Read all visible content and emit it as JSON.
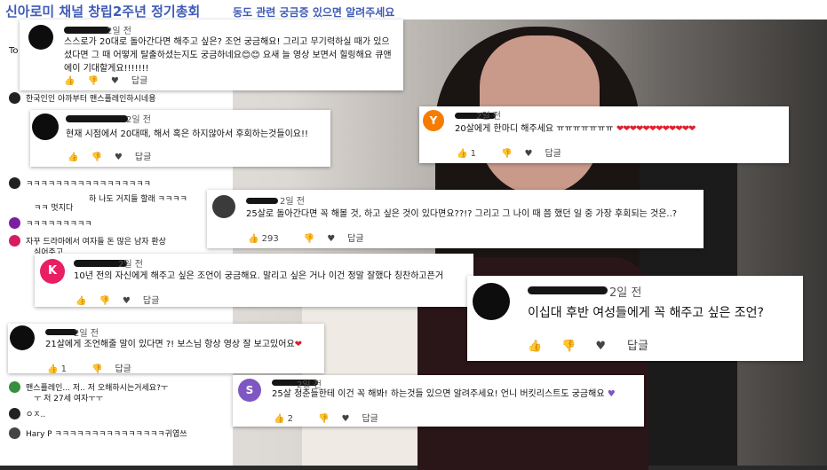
{
  "header": {
    "title": "신아로미 채널 창립2주년 정기총회",
    "subtitle": "동도 관련 궁금증 있으면 알려주세요"
  },
  "left_panel": {
    "tab": "To",
    "rows": [
      {
        "name": "한국인인 아까부터 맨스플레인하시네용"
      },
      {
        "name": "ㅋㅋㅋㅋㅋㅋㅋㅋㅋㅋㅋㅋㅋㅋㅋㅋㅋ"
      },
      {
        "name": "하 나도 거지들 할래 ㅋㅋㅋㅋ"
      },
      {
        "name": "ㅋㅋ 멋지다"
      },
      {
        "name": "ㅋㅋㅋㅋㅋㅋㅋㅋㅋ"
      },
      {
        "name": "자꾸 드라마에서 여자들 돈 많은 남자 환상"
      },
      {
        "name": "심어주고"
      },
      {
        "name": "맨스플레인... 저.. 저 오해하시는거세요?ㅜ"
      },
      {
        "name": "ㅜ 저 27세 여자ㅜㅜ"
      },
      {
        "name": "ㅇㅈ.."
      },
      {
        "name": "Hary P  ㅋㅋㅋㅋㅋㅋㅋㅋㅋㅋㅋㅋㅋㅋㅋ귀엽쓰"
      }
    ]
  },
  "comments": [
    {
      "id": "c1",
      "time": "2일 전",
      "text": "스스로가 20대로 돌아간다면 해주고 싶은? 조언 궁금해요! 그리고 무기력하실 때가 있으셨다면 그 때 어떻게 탈출하셨는지도 궁금하네요😊😊 요새 늘 영상 보면서 힐링해요 큐앤에이 기대할게요!!!!!!!",
      "likes": "",
      "reply": "답글"
    },
    {
      "id": "c2",
      "time": "2일 전",
      "text": "현재 시점에서 20대때, 해서 혹은 하지않아서 후회하는것들이요!!",
      "likes": "",
      "reply": "답글"
    },
    {
      "id": "c3",
      "letter": "Y",
      "color": "#f57c00",
      "time": "2일 전",
      "text": "20살에게 한마디 해주세요 ㅠㅠㅠㅠㅠㅠㅠ",
      "hearts": "❤❤❤❤❤❤❤❤❤❤❤❤",
      "likes": "1",
      "reply": "답글"
    },
    {
      "id": "c4",
      "time": "2일 전",
      "text": "25살로 돌아간다면 꼭 해볼 것, 하고 싶은 것이 있다면요??!? 그리고 그 나이 때 쯤 했던 일 중 가장 후회되는 것은..?",
      "likes": "293",
      "reply": "답글"
    },
    {
      "id": "c5",
      "letter": "K",
      "color": "#e91e63",
      "time": "2일 전",
      "text": "10년 전의 자신에게 해주고 싶은 조언이 궁금해요. 말리고 싶은 거나 이건 정말 잘했다 칭찬하고픈거",
      "likes": "",
      "reply": "답글"
    },
    {
      "id": "c6",
      "time": "2일 전",
      "text": "이십대 후반 여성들에게 꼭 해주고 싶은 조언?",
      "likes": "",
      "reply": "답글"
    },
    {
      "id": "c7",
      "time": "2일 전",
      "text": "21살에게 조언해줄 말이 있다면 ?! 보스님 항상 영상 잘 보고있어요",
      "likes": "1",
      "reply": "답글"
    },
    {
      "id": "c8",
      "letter": "S",
      "color": "#7e57c2",
      "time": "2일 전",
      "text": "25살 청춘들한테 이건 꼭 해봐! 하는것들 있으면 알려주세요! 언니 버킷리스트도 궁금해요",
      "likes": "2",
      "reply": "답글"
    }
  ],
  "icons": {
    "like": "thumbs-up-icon",
    "dislike": "thumbs-down-icon",
    "heart": "heart-icon"
  },
  "colors": {
    "heart": "#e01f2b",
    "title": "#3e5bb8"
  }
}
